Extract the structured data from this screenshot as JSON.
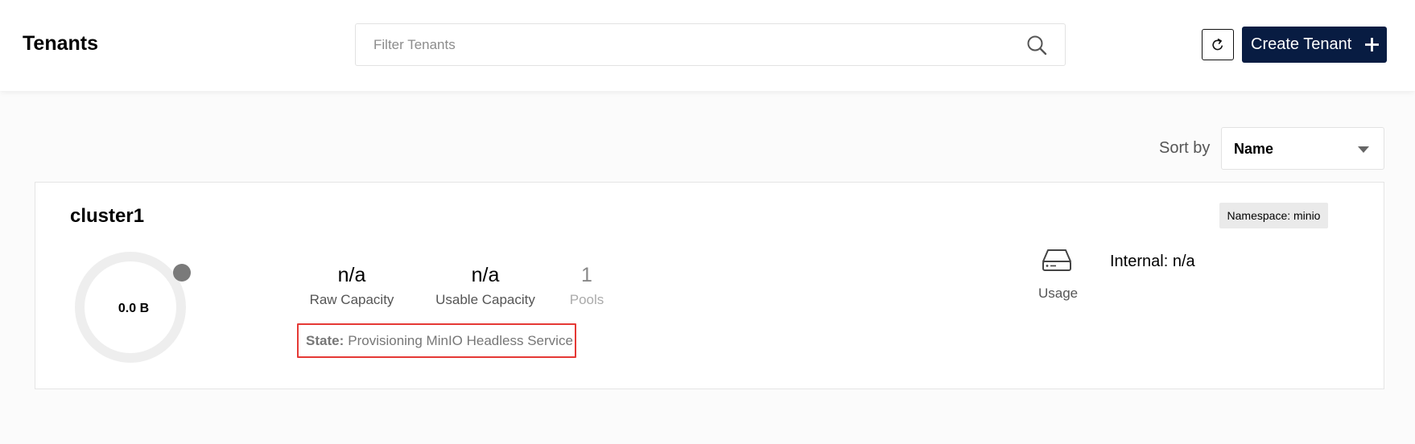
{
  "header": {
    "title": "Tenants",
    "search": {
      "placeholder": "Filter Tenants",
      "value": ""
    },
    "create_label": "Create Tenant"
  },
  "sort": {
    "label": "Sort by",
    "selected": "Name"
  },
  "tenant": {
    "name": "cluster1",
    "namespace_badge": "Namespace: minio",
    "usage_ring_label": "0.0 B",
    "metrics": [
      {
        "value": "n/a",
        "label": "Raw Capacity"
      },
      {
        "value": "n/a",
        "label": "Usable Capacity"
      },
      {
        "value": "1",
        "label": "Pools"
      }
    ],
    "state": {
      "key": "State:",
      "value": "Provisioning MinIO Headless Service"
    },
    "usage": {
      "label": "Usage",
      "internal": "Internal: n/a"
    }
  },
  "colors": {
    "primary": "#081c42",
    "state_highlight": "#e53935",
    "ring_track": "#eeeeee",
    "ring_dot": "#7a7a7a"
  },
  "icons": [
    "search-icon",
    "refresh-icon",
    "plus-icon",
    "chevron-down-icon",
    "drive-icon"
  ]
}
